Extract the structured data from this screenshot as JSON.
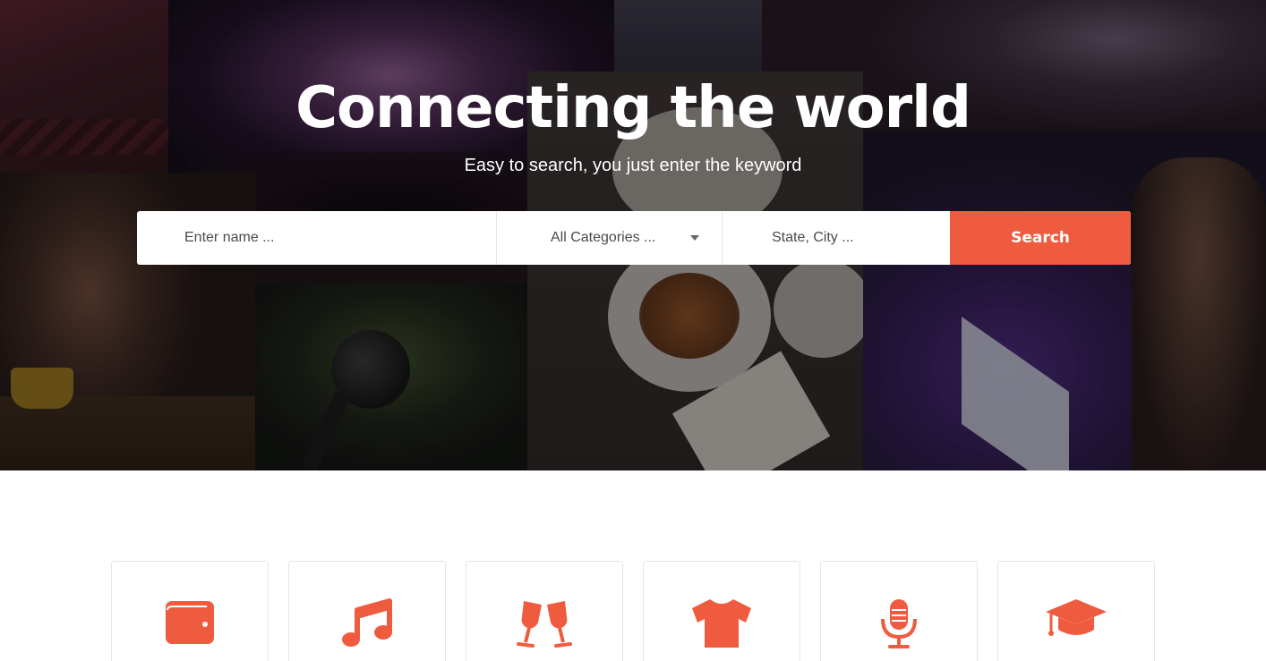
{
  "hero": {
    "title": "Connecting the world",
    "subtitle": "Easy to search, you just enter the keyword"
  },
  "search": {
    "name_placeholder": "Enter name ...",
    "category_selected": "All Categories ...",
    "location_placeholder": "State, City ...",
    "button_label": "Search"
  },
  "colors": {
    "accent": "#ef5b3f"
  },
  "categories": [
    {
      "icon": "wallet-icon"
    },
    {
      "icon": "music-note-icon"
    },
    {
      "icon": "cheers-glasses-icon"
    },
    {
      "icon": "tshirt-icon"
    },
    {
      "icon": "microphone-icon"
    },
    {
      "icon": "graduation-cap-icon"
    }
  ]
}
